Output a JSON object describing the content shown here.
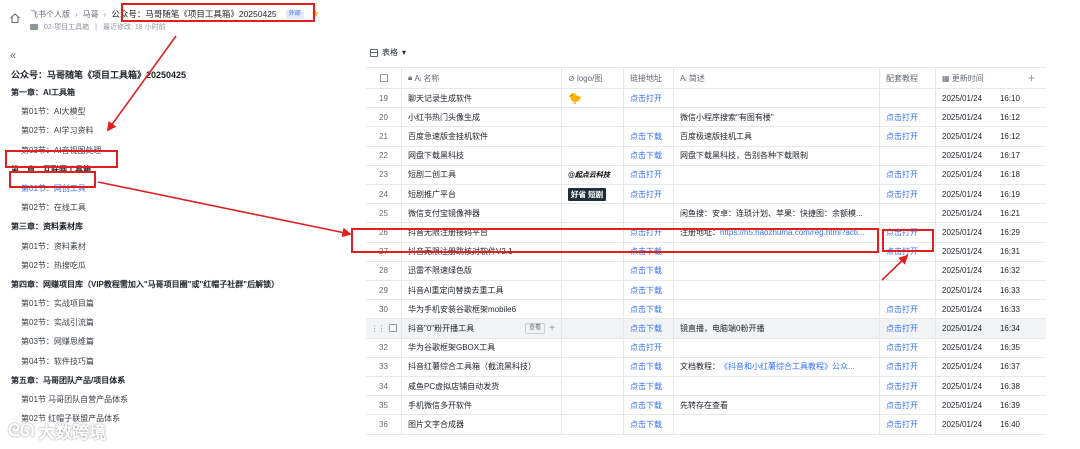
{
  "header": {
    "breadcrumbs": [
      "飞书个人版",
      "马哥"
    ],
    "current": "公众号：马哥随笔《项目工具箱》20250425",
    "tag": "外部",
    "subcrumb_folder": "02-项目工具箱",
    "subcrumb_updated": "最近修改: 18 小时前"
  },
  "sidebar": {
    "doc_title": "公众号：马哥随笔《项目工具箱》20250425",
    "items": [
      {
        "label": "第一章：AI工具箱",
        "level": 1
      },
      {
        "label": "第01节：AI大模型",
        "level": 2
      },
      {
        "label": "第02节：AI学习资料",
        "level": 2
      },
      {
        "label": "第03节：AI音视图处理",
        "level": 2
      },
      {
        "label": "第二章：互联网工具箱",
        "level": 1
      },
      {
        "label": "第01节：网创工具",
        "level": 2,
        "active": true
      },
      {
        "label": "第02节：在线工具",
        "level": 2
      },
      {
        "label": "第三章：资料素材库",
        "level": 1
      },
      {
        "label": "第01节：资料素材",
        "level": 2
      },
      {
        "label": "第02节：热搜吃瓜",
        "level": 2
      },
      {
        "label": "第四章：网赚项目库（VIP教程需加入\"马哥项目圈\"或\"红帽子社群\"后解锁）",
        "level": 1
      },
      {
        "label": "第01节：实战项目篇",
        "level": 2
      },
      {
        "label": "第02节：实战引流篇",
        "level": 2
      },
      {
        "label": "第03节：网赚思维篇",
        "level": 2
      },
      {
        "label": "第04节：软件技巧篇",
        "level": 2
      },
      {
        "label": "第五章：马哥团队产品/项目体系",
        "level": 1
      },
      {
        "label": "第01节 马哥团队自营产品体系",
        "level": 2
      },
      {
        "label": "第02节 红帽子联盟产品体系",
        "level": 2
      }
    ]
  },
  "toolbar": {
    "view_label": "表格"
  },
  "table": {
    "headers": {
      "name": "名称",
      "logo": "logo/图",
      "url": "链接地址",
      "desc": "简述",
      "tutorial": "配套教程",
      "time": "更新时间"
    },
    "rows": [
      {
        "num": "19",
        "name": "聊天记录生成软件",
        "logo": "emoji",
        "url": "点击打开",
        "desc": "",
        "tutorial": "",
        "date": "2025/01/24",
        "time": "16:10"
      },
      {
        "num": "20",
        "name": "小红书热门头像生成",
        "logo": "",
        "url": "",
        "desc": "微信小程序搜索\"有图有楼\"",
        "tutorial": "点击打开",
        "date": "2025/01/24",
        "time": "16:12"
      },
      {
        "num": "21",
        "name": "百度急速版金挂机软件",
        "logo": "",
        "url": "点击下载",
        "desc": "百度极速版挂机工具",
        "tutorial": "点击打开",
        "date": "2025/01/24",
        "time": "16:12"
      },
      {
        "num": "22",
        "name": "网盘下载黑科技",
        "logo": "",
        "url": "点击下载",
        "desc": "网盘下载黑科技，告别各种下载限制",
        "tutorial": "",
        "date": "2025/01/24",
        "time": "16:17"
      },
      {
        "num": "23",
        "name": "短剧二创工具",
        "logo": "@起点云科技",
        "url": "点击打开",
        "desc": "",
        "tutorial": "点击打开",
        "date": "2025/01/24",
        "time": "16:18"
      },
      {
        "num": "24",
        "name": "短剧推广平台",
        "logo": "好省 短剧",
        "url": "点击打开",
        "desc": "",
        "tutorial": "点击打开",
        "date": "2025/01/24",
        "time": "16:19"
      },
      {
        "num": "25",
        "name": "微信支付宝镜像神器",
        "logo": "",
        "url": "",
        "desc": "闲鱼搜：安卓：连琐计划、苹果：快捷图：余额模...",
        "tutorial": "",
        "date": "2025/01/24",
        "time": "16:21"
      },
      {
        "num": "26",
        "name": "抖音无限注册接码平台",
        "logo": "",
        "url": "点击打开",
        "desc_prefix": "注册地址：",
        "desc_link": "https://h5.haozhuma.com/reg.html?acti...",
        "tutorial": "点击打开",
        "date": "2025/01/24",
        "time": "16:29"
      },
      {
        "num": "27",
        "name": "抖音无限注册跳核对软件V2.1",
        "logo": "",
        "url": "点击下载",
        "desc": "",
        "tutorial": "点击打开",
        "date": "2025/01/24",
        "time": "16:31"
      },
      {
        "num": "28",
        "name": "迅雷不限速绿色版",
        "logo": "",
        "url": "点击下载",
        "desc": "",
        "tutorial": "",
        "date": "2025/01/24",
        "time": "16:32"
      },
      {
        "num": "29",
        "name": "抖音AI重定向替换去重工具",
        "logo": "",
        "url": "点击下载",
        "desc": "",
        "tutorial": "",
        "date": "2025/01/24",
        "time": "16:33"
      },
      {
        "num": "30",
        "name": "华为手机安装谷歌框架mobile6",
        "logo": "",
        "url": "点击下载",
        "desc": "",
        "tutorial": "点击打开",
        "date": "2025/01/24",
        "time": "16:33"
      },
      {
        "num": "",
        "name": "抖音\"0\"粉开播工具",
        "logo": "",
        "url": "点击下载",
        "desc": "镜直播，电脑端0粉开播",
        "tutorial": "点击打开",
        "date": "2025/01/24",
        "time": "16:34",
        "hover": true
      },
      {
        "num": "32",
        "name": "华为谷歌框架GBOX工具",
        "logo": "",
        "url": "点击打开",
        "desc": "",
        "tutorial": "点击打开",
        "date": "2025/01/24",
        "time": "16:35"
      },
      {
        "num": "33",
        "name": "抖音红薯综合工具箱（截流黑科技）",
        "logo": "",
        "url": "点击下载",
        "desc_prefix": "文档教程：",
        "desc_link": "《抖音和小红薯综合工具教程》公众...",
        "tutorial": "点击打开",
        "date": "2025/01/24",
        "time": "16:37"
      },
      {
        "num": "34",
        "name": "咸鱼PC虚拟店铺自动发货",
        "logo": "",
        "url": "点击下载",
        "desc": "",
        "tutorial": "点击打开",
        "date": "2025/01/24",
        "time": "16:38"
      },
      {
        "num": "35",
        "name": "手机微信多开软件",
        "logo": "",
        "url": "点击下载",
        "desc": "先转存在查看",
        "tutorial": "点击打开",
        "date": "2025/01/24",
        "time": "16:39"
      },
      {
        "num": "36",
        "name": "图片文字合成器",
        "logo": "",
        "url": "点击下载",
        "desc": "",
        "tutorial": "点击打开",
        "date": "2025/01/24",
        "time": "16:40"
      }
    ],
    "open_label": "查看"
  },
  "watermark": {
    "text": "大数跨境"
  },
  "colors": {
    "accent": "#3370ff",
    "annotation": "#e02020",
    "star": "#f7ba1e"
  }
}
